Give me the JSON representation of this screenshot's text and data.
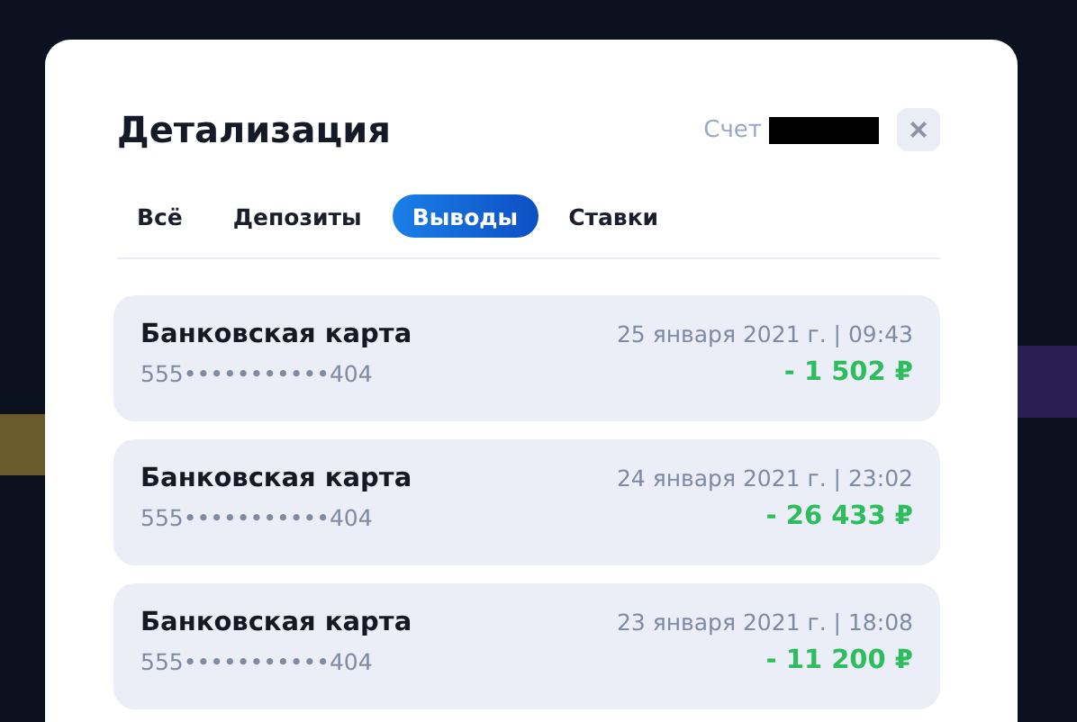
{
  "modal": {
    "title": "Детализация",
    "account_label": "Счет",
    "account_redacted": true,
    "close": "×"
  },
  "tabs": [
    {
      "label": "Всё",
      "selected": false
    },
    {
      "label": "Депозиты",
      "selected": false
    },
    {
      "label": "Выводы",
      "selected": true
    },
    {
      "label": "Ставки",
      "selected": false
    }
  ],
  "transactions": [
    {
      "method": "Банковская карта",
      "card": "555•••••••••••404",
      "date": "25 января 2021 г. | 09:43",
      "amount": "- 1 502 ₽"
    },
    {
      "method": "Банковская карта",
      "card": "555•••••••••••404",
      "date": "24 января 2021 г. | 23:02",
      "amount": "- 26 433 ₽"
    },
    {
      "method": "Банковская карта",
      "card": "555•••••••••••404",
      "date": "23 января 2021 г. | 18:08",
      "amount": "- 11 200 ₽"
    }
  ]
}
